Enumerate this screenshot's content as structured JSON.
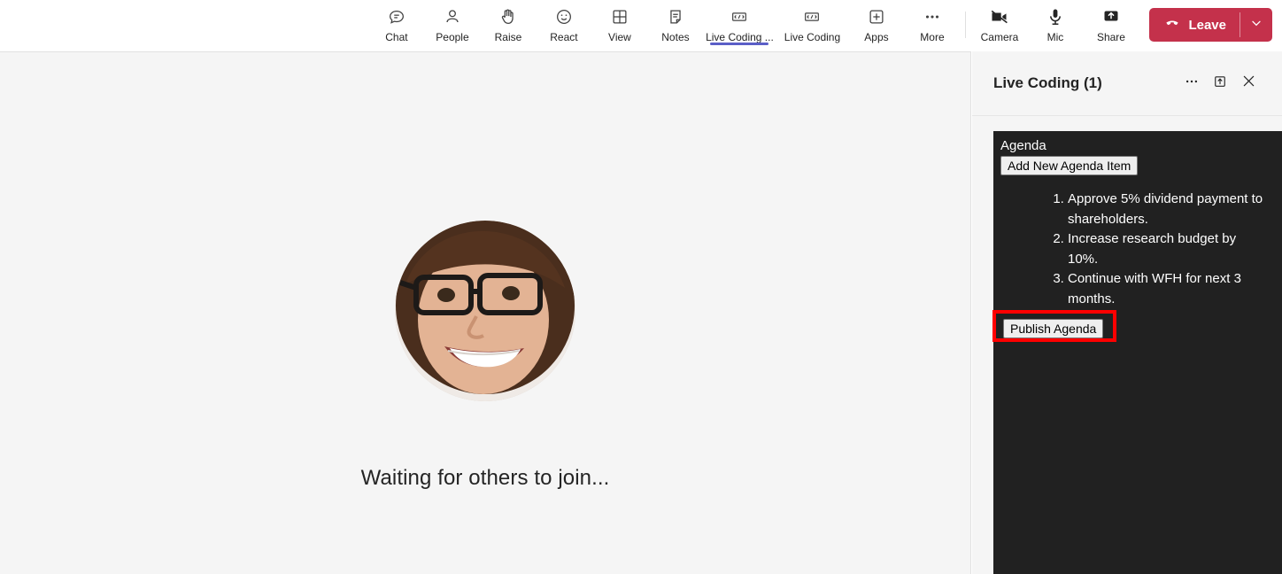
{
  "toolbar": {
    "items": [
      {
        "label": "Chat",
        "icon": "chat-icon"
      },
      {
        "label": "People",
        "icon": "people-icon"
      },
      {
        "label": "Raise",
        "icon": "raise-hand-icon"
      },
      {
        "label": "React",
        "icon": "react-emoji-icon"
      },
      {
        "label": "View",
        "icon": "view-grid-icon"
      },
      {
        "label": "Notes",
        "icon": "notes-icon"
      },
      {
        "label": "Live Coding ...",
        "icon": "live-coding-app-icon",
        "active": true
      },
      {
        "label": "Live Coding",
        "icon": "live-coding-app-icon"
      },
      {
        "label": "Apps",
        "icon": "apps-plus-icon"
      },
      {
        "label": "More",
        "icon": "more-ellipsis-icon"
      }
    ],
    "media": [
      {
        "label": "Camera",
        "icon": "camera-off-icon"
      },
      {
        "label": "Mic",
        "icon": "microphone-icon"
      },
      {
        "label": "Share",
        "icon": "share-screen-icon"
      }
    ],
    "leave": {
      "label": "Leave",
      "icon": "hang-up-icon",
      "caret_icon": "chevron-down-icon",
      "color": "#c4314b"
    },
    "active_underline_color": "#5b5fc7"
  },
  "stage": {
    "avatar_name": "participant-avatar",
    "message": "Waiting for others to join..."
  },
  "panel": {
    "title": "Live Coding (1)",
    "actions": [
      {
        "name": "more-options-icon",
        "glyph": "more-ellipsis-icon"
      },
      {
        "name": "pop-out-icon",
        "glyph": "pop-out-icon"
      },
      {
        "name": "close-panel-icon",
        "glyph": "close-icon"
      }
    ],
    "app": {
      "heading": "Agenda",
      "add_button_label": "Add New Agenda Item",
      "items": [
        "Approve 5% dividend payment to shareholders.",
        "Increase research budget by 10%.",
        "Continue with WFH for next 3 months."
      ],
      "publish_button_label": "Publish Agenda",
      "background_color": "#212121",
      "highlight_color": "#ff0000"
    }
  }
}
